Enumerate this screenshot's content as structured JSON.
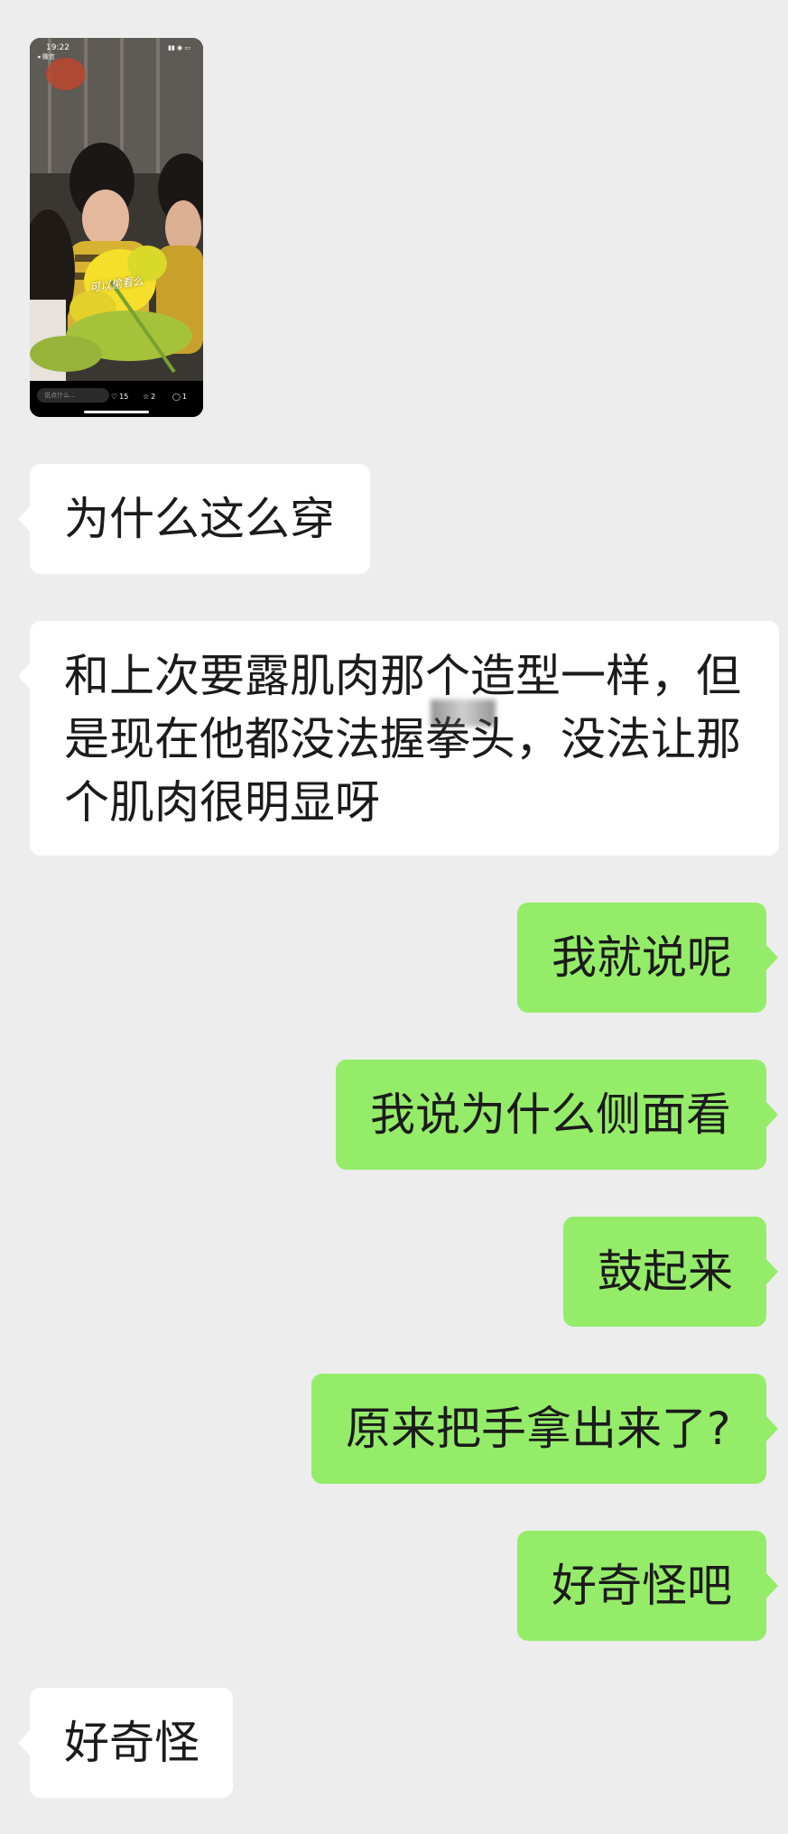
{
  "video_thumbnail": {
    "status_time": "19:22",
    "back_label": "◂ 微信",
    "comment_placeholder": "说点什么...",
    "likes": "15",
    "favorites": "2",
    "comments": "1",
    "progress": 0.2,
    "overlay_text": "可以偷看么"
  },
  "messages": [
    {
      "side": "incoming",
      "text": "为什么这么穿"
    },
    {
      "side": "incoming",
      "text": "和上次要露肌肉那个造型一样，但是现在他都没法握拳头，没法让那个肌肉很明显呀"
    },
    {
      "side": "outgoing",
      "text": "我就说呢"
    },
    {
      "side": "outgoing",
      "text": "我说为什么侧面看"
    },
    {
      "side": "outgoing",
      "text": "鼓起来"
    },
    {
      "side": "outgoing",
      "text": "原来把手拿出来了?"
    },
    {
      "side": "outgoing",
      "text": "好奇怪吧"
    },
    {
      "side": "incoming",
      "text": "好奇怪"
    }
  ],
  "colors": {
    "background": "#ededed",
    "incoming_bubble": "#ffffff",
    "outgoing_bubble": "#95ec69",
    "text": "#1b1b1b"
  }
}
